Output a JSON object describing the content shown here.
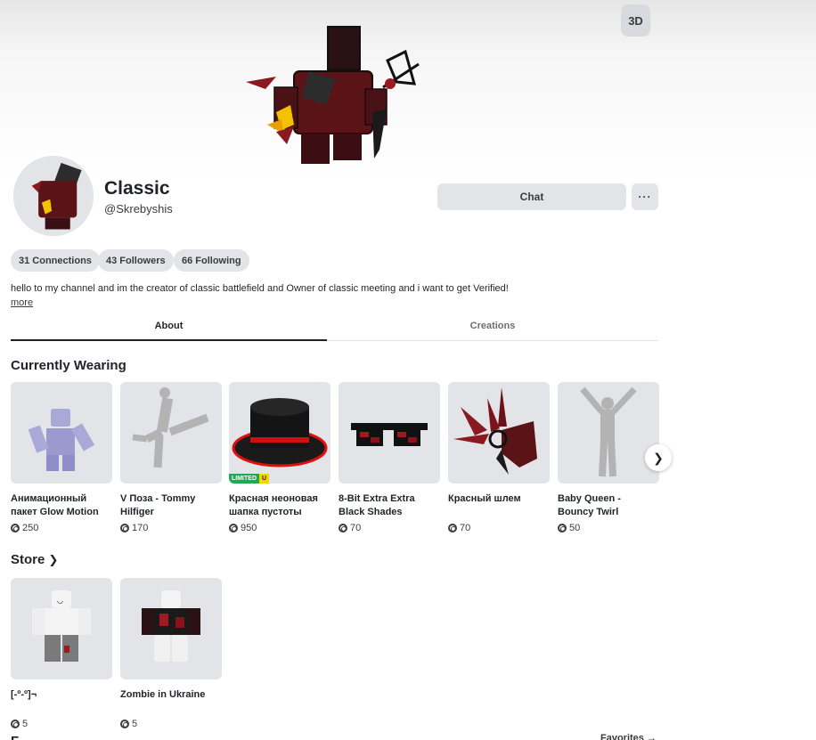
{
  "hero": {
    "view_3d_label": "3D"
  },
  "profile": {
    "display_name": "Classic",
    "username": "@Skrebyshis",
    "chat_label": "Chat",
    "more_label": "···",
    "connections": "31 Connections",
    "followers": "43 Followers",
    "following": "66 Following",
    "bio": "hello to my channel and im the creator of classic battlefield and Owner of classic meeting and i want to get Verified!",
    "bio_more": "more"
  },
  "tabs": [
    {
      "label": "About",
      "active": true
    },
    {
      "label": "Creations",
      "active": false
    }
  ],
  "currently_wearing": {
    "title": "Currently Wearing",
    "items": [
      {
        "name": "Анимационный пакет Glow Motion",
        "price": "250",
        "icon": "lavender-rig-avatar"
      },
      {
        "name": "V Поза - Tommy Hilfiger",
        "price": "170",
        "icon": "gray-pose-silhouette"
      },
      {
        "name": "Красная неоновая шапка пустоты",
        "price": "950",
        "icon": "black-red-top-hat",
        "badge": "LIMITED",
        "badge_u": "U"
      },
      {
        "name": "8-Bit Extra Extra Black Shades",
        "price": "70",
        "icon": "pixel-sunglasses"
      },
      {
        "name": "Красный шлем",
        "price": "70",
        "icon": "red-spiked-helmet"
      },
      {
        "name": "Baby Queen - Bouncy Twirl",
        "price": "50",
        "icon": "gray-arms-up-silhouette"
      }
    ]
  },
  "store": {
    "title": "Store",
    "items": [
      {
        "name": "[-º-º]¬",
        "price": "5",
        "icon": "white-avatar-gray-pants"
      },
      {
        "name": "Zombie in Ukraine",
        "price": "5",
        "icon": "white-avatar-black-red-outfit"
      }
    ]
  },
  "bottom": {
    "section_title": "F",
    "favorites_link": "Favorites →"
  },
  "colors": {
    "card_bg": "#e3e4e8",
    "pill_bg": "#e3e4e8",
    "text_dark": "#1f2328",
    "limited_green": "#1fa954",
    "limited_yellow": "#f7d300"
  }
}
